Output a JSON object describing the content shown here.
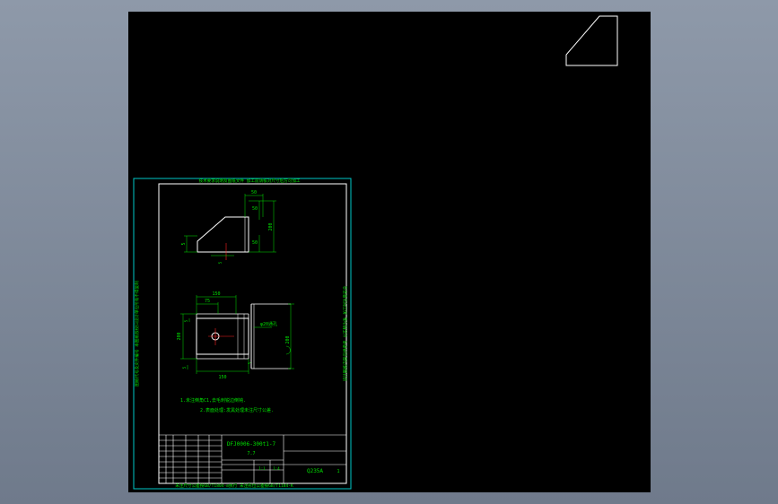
{
  "drawing": {
    "title_top": "技术要求说明及图纸文件 加工前请核对尺寸后方可加工",
    "title_bottom": "未注尺寸公差按GB/T1804-m执行 未注形位公差按GB/T1184-K",
    "side_left": "图纸代号及文件编号 本图纸版权归设计单位所有不得复制",
    "side_right": "设计图纸内容仅供参考 以实物为准 加工时注意安全",
    "dims": {
      "top_width": "50",
      "top_right_1": "50",
      "top_right_2": "50",
      "top_height": "200",
      "left_thick": "5",
      "bottom_small": "5",
      "plan_top": "150",
      "plan_inner": "75",
      "plan_left": "200",
      "plan_bottom": "150",
      "plan_tag": "5",
      "side_label": "φ20通孔",
      "side_height": "200",
      "small_1": "5",
      "small_2": "5"
    },
    "notes": [
      "1.未注倒角C1,去毛刺锐边倒钝.",
      "2.表面处理:发黑处理未注尺寸公差."
    ],
    "title_block": {
      "drawing_no": "DFJ0006-300t1-7",
      "name": "7.7",
      "material": "Q235A",
      "qty": "1",
      "scale": "1:4",
      "sheet": "1:1"
    },
    "colors": {
      "background": "#000000",
      "lines": "#ffffff",
      "dimensions": "#00e000",
      "frame": "#00c8c8",
      "center": "#ff2020"
    }
  }
}
